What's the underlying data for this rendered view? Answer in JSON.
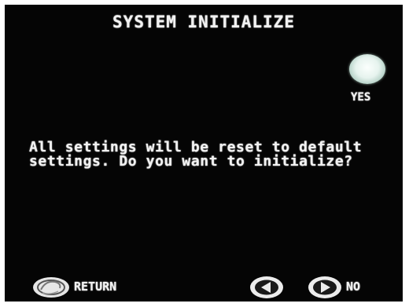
{
  "screen": {
    "title": "SYSTEM INITIALIZE",
    "message_lines": [
      "All settings will be reset to default",
      "settings. Do you want to initialize?"
    ]
  },
  "controls": {
    "yes_label": "YES",
    "return_label": "RETURN",
    "no_label": "NO"
  },
  "icons": {
    "yes": "round-button-icon",
    "return": "return-button-icon",
    "left": "left-arrow-icon",
    "right": "right-arrow-icon"
  },
  "colors": {
    "background": "#050505",
    "text": "#f2f2f2",
    "button_glow": "#dff3ea"
  }
}
